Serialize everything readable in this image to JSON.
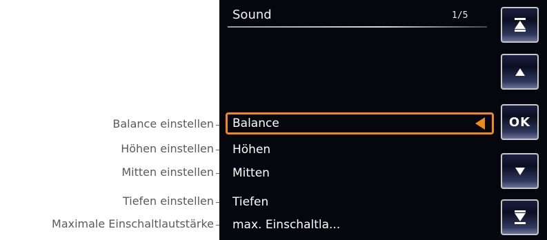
{
  "callouts": [
    "Balance einstellen",
    "Höhen einstellen",
    "Mitten einstellen",
    "Tiefen einstellen",
    "Maximale Einschaltlautstärke"
  ],
  "menu": {
    "title": "Sound",
    "page_indicator": "1/5",
    "selected_index": 0,
    "items": [
      "Balance",
      "Höhen",
      "Mitten",
      "Tiefen",
      "max. Einschaltla..."
    ]
  },
  "buttons": {
    "first": "first-page-icon",
    "up": "arrow-up-icon",
    "ok_label": "OK",
    "down": "arrow-down-icon",
    "last": "last-page-icon"
  },
  "colors": {
    "screen_background": "#05060e",
    "selection_accent": "#f08a14",
    "button_border": "#c8c8c8"
  }
}
